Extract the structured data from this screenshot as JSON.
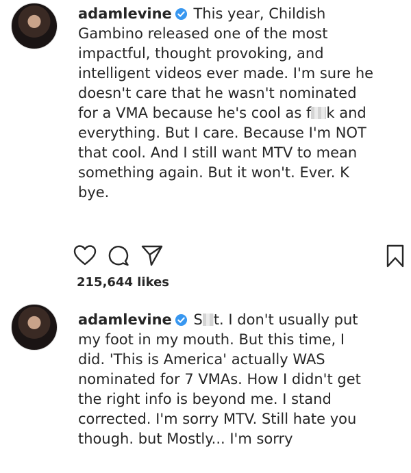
{
  "posts": [
    {
      "username": "adamlevine",
      "caption_lines": [
        "This year, Childish",
        "Gambino released one of the most",
        "impactful, thought provoking, and",
        "intelligent videos ever made. I'm sure he",
        "doesn't care that he wasn't nominated",
        "for a VMA because he's cool as f",
        "k and",
        "everything. But I care. Because I'm NOT",
        "that cool. And I still want MTV to mean",
        "something again. But it won't. Ever. K",
        "bye."
      ],
      "likes": "215,644 likes"
    },
    {
      "username": "adamlevine",
      "caption_lines": [
        "S",
        "t. I don't usually put",
        "my foot in my mouth. But this time, I",
        "did. 'This is America' actually WAS",
        "nominated for 7 VMAs. How I didn't get",
        "the right info is beyond me. I stand",
        "corrected. I'm sorry MTV. Still hate you",
        "though. but Mostly... I'm sorry"
      ]
    }
  ],
  "icons": {
    "verified": "verified-badge-icon",
    "like": "heart-icon",
    "comment": "comment-icon",
    "share": "paper-plane-icon",
    "save": "bookmark-icon"
  },
  "colors": {
    "verified_blue": "#3897f0",
    "text": "#262626"
  }
}
